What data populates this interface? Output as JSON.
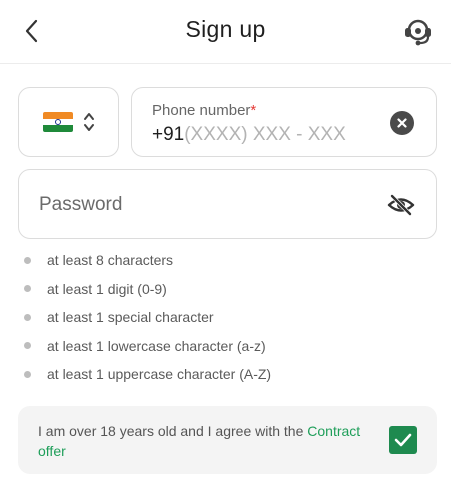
{
  "header": {
    "title": "Sign up",
    "back_icon": "chevron-left-icon",
    "support_icon": "headset-support-icon"
  },
  "phone": {
    "country_flag": "india-flag",
    "label": "Phone number",
    "required_mark": "*",
    "prefix": "+91",
    "mask": "(XXXX) XXX - XXX",
    "clear_icon": "clear-icon"
  },
  "password": {
    "placeholder": "Password",
    "toggle_icon": "eye-off-icon"
  },
  "rules": [
    "at least 8 characters",
    "at least 1 digit (0-9)",
    "at least 1 special character",
    "at least 1 lowercase character (a-z)",
    "at least 1 uppercase character (A-Z)"
  ],
  "agreement": {
    "text": "I am over 18 years old and I agree with the ",
    "link_text": "Contract offer",
    "checked": true
  },
  "colors": {
    "accent": "#1e8a4f",
    "link": "#1e9e59",
    "required": "#e53935"
  }
}
